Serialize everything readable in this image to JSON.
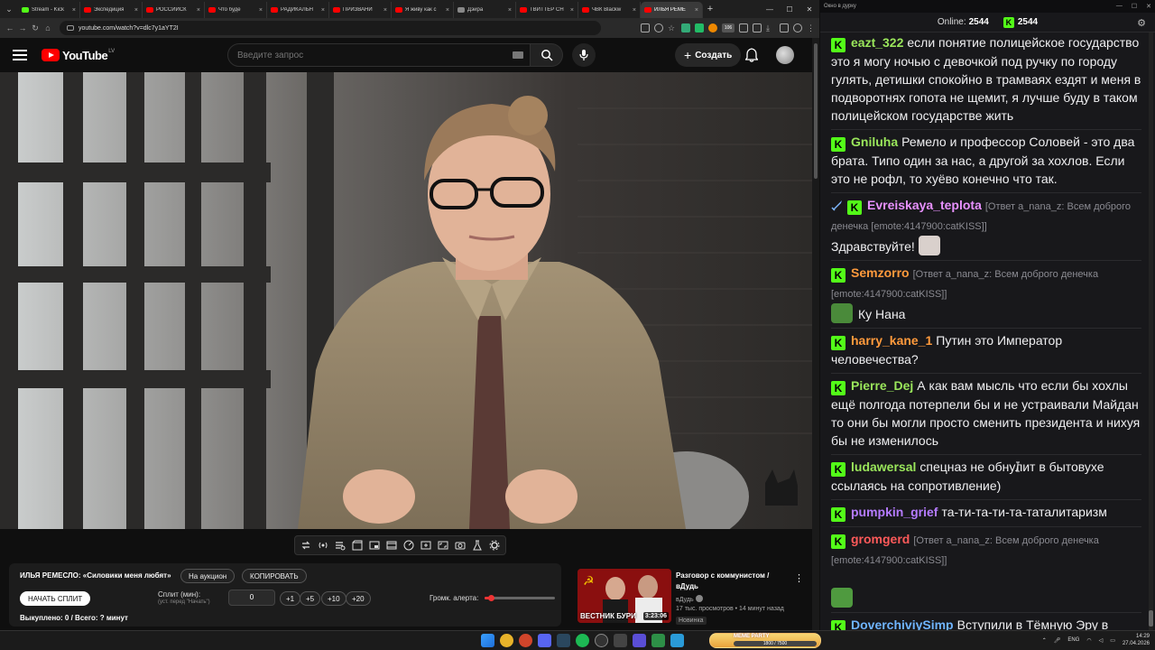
{
  "browser": {
    "tabs": [
      {
        "title": "Stream - Kick",
        "color": "#53fc18",
        "active": false
      },
      {
        "title": "Экспедиция",
        "color": "#ff0000",
        "active": false
      },
      {
        "title": "РОССИЙСК",
        "color": "#ff0000",
        "active": false
      },
      {
        "title": "Что буде",
        "color": "#ff0000",
        "active": false
      },
      {
        "title": "РАДИКАЛЬН",
        "color": "#ff0000",
        "active": false
      },
      {
        "title": "ПРИЗВАНИ",
        "color": "#ff0000",
        "active": false
      },
      {
        "title": "Я живу как с",
        "color": "#ff0000",
        "active": false
      },
      {
        "title": "Дэйра",
        "color": "#888888",
        "active": false
      },
      {
        "title": "ТВИТТЕР СН",
        "color": "#ff0000",
        "active": false
      },
      {
        "title": "ЧВК Blackw",
        "color": "#ff0000",
        "active": false
      },
      {
        "title": "ИЛЬЯ РЕМЕ",
        "color": "#ff0000",
        "active": true
      }
    ],
    "url": "youtube.com/watch?v=dlc7y1aYT2I",
    "new_tab": "+",
    "extension_badge": "106"
  },
  "youtube": {
    "logo": "YouTube",
    "country": "LV",
    "search_placeholder": "Введите запрос",
    "create_label": "Создать"
  },
  "chat_tool": {
    "title": "ИЛЬЯ РЕМЕСЛО: «Силовики меня любят»",
    "auction": "На аукцион",
    "copy": "КОПИРОВАТЬ",
    "start_split": "НАЧАТЬ СПЛИТ",
    "split_label": "Сплит (мин):",
    "split_hint": "(уст. перед \"Начать\")",
    "split_value": "0",
    "increments": [
      "+1",
      "+5",
      "+10",
      "+20"
    ],
    "volume_label": "Громк. алерта:",
    "volume_level_percent": 7,
    "status": "Выкуплено: 0 / Всего: ? минут"
  },
  "recommendation": {
    "title": "Разговор с коммунистом / вДудь",
    "channel": "вДудь",
    "meta": "17 тыс. просмотров • 14 минут назад",
    "badge": "Новинка",
    "duration": "3:23:06",
    "thumb_text": "ВЕСТНИК БУРИ"
  },
  "chat": {
    "window_title": "Окно в дурку",
    "online_label": "Online:",
    "online_count": "2544",
    "kick_count": "2544",
    "messages": [
      {
        "user": "eazt_322",
        "color": "green",
        "reply": "",
        "text": "если понятие полицейское государство это я могу ночью с девочкой под ручку по городу гулять, детишки спокойно в трамваях ездят и меня в подворотнях гопота не щемит, я лучше буду в таком полицейском государстве жить",
        "emote": ""
      },
      {
        "user": "Gniluha",
        "color": "green",
        "reply": "",
        "text": "Ремело и профессор Соловей - это два брата. Типо один за нас, а другой за хохлов. Если это не рофл, то хуёво конечно что так.",
        "emote": ""
      },
      {
        "user": "Evreiskaya_teplota",
        "color": "pink",
        "reply": "[Ответ a_nana_z: Всем доброго денечка [emote:4147900:catKISS]]",
        "text": "Здравствуйте!",
        "emote": "cat"
      },
      {
        "user": "Semzorro",
        "color": "orange",
        "reply": "[Ответ a_nana_z: Всем доброго денечка [emote:4147900:catKISS]]",
        "text": "Ку Нана",
        "emote": "pepe-hand"
      },
      {
        "user": "harry_kane_1",
        "color": "orange",
        "reply": "",
        "text": "Путин это Император человечества?",
        "emote": ""
      },
      {
        "user": "Pierre_Dej",
        "color": "green",
        "reply": "",
        "text": "А как вам мысль что если бы хохлы ещё полгода потерпели бы и не устраивали Майдан то они бы могли просто сменить президента и нихуя бы не изменилось",
        "emote": ""
      },
      {
        "user": "ludawersal",
        "color": "green",
        "reply": "",
        "text": "спецназ не обнулит в бытовухе ссылаясь на сопротивление)",
        "emote": ""
      },
      {
        "user": "pumpkin_grief",
        "color": "violet",
        "reply": "",
        "text": "та-ти-та-ти-та-таталитаризм",
        "emote": ""
      },
      {
        "user": "gromgerd",
        "color": "red",
        "reply": "[Ответ a_nana_z: Всем доброго денечка [emote:4147900:catKISS]]",
        "text": "",
        "emote": "pepe"
      },
      {
        "user": "DoverchiviySimp",
        "color": "blue",
        "reply": "",
        "text": "Вступили в Тёмную Эру в общем.",
        "emote": ""
      }
    ]
  },
  "taskbar": {
    "meme_party_label": "MEME PARTY",
    "meme_party_progress": "1800 / 7500",
    "lang": "ENG",
    "time": "14:29",
    "date": "27.04.2026"
  }
}
